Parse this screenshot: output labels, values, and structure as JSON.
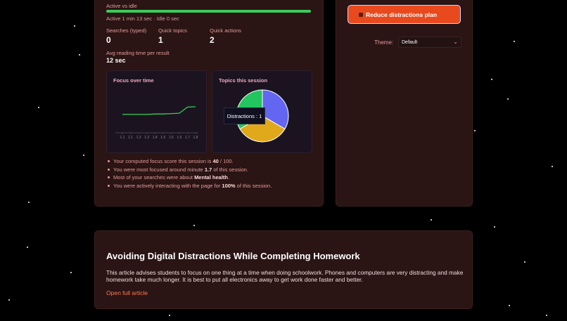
{
  "activity": {
    "title": "Active vs idle",
    "status": "Active 1 min 13 sec · Idle 0 sec",
    "active_fraction": 1.0,
    "bar_color": "#3ccb5b"
  },
  "stats": [
    {
      "label": "Searches (typed)",
      "value": "0"
    },
    {
      "label": "Quick topics",
      "value": "1"
    },
    {
      "label": "Quick actions",
      "value": "2"
    }
  ],
  "reading": {
    "label": "Avg reading time per result",
    "value": "12 sec"
  },
  "focus_chart": {
    "title": "Focus over time",
    "x_ticks": [
      "1.1",
      "1.1",
      "1.2",
      "1.3",
      "1.4",
      "1.5",
      "1.6",
      "1.6",
      "1.7",
      "1.8"
    ],
    "chart_data": {
      "type": "line",
      "x": [
        "1.1",
        "1.1",
        "1.2",
        "1.3",
        "1.4",
        "1.5",
        "1.6",
        "1.6",
        "1.7",
        "1.8"
      ],
      "y": [
        0.45,
        0.45,
        0.45,
        0.45,
        0.46,
        0.46,
        0.47,
        0.48,
        0.63,
        0.64
      ],
      "color": "#3ccb5b"
    }
  },
  "topics_chart": {
    "title": "Topics this session",
    "tooltip": "Distractions : 1",
    "chart_data": {
      "type": "pie",
      "slices": [
        {
          "name": "Distractions",
          "value": 1,
          "color": "#6366f1"
        },
        {
          "name": "",
          "value": 1,
          "color": "#e0a91c"
        },
        {
          "name": "",
          "value": 1,
          "color": "#22c55e"
        }
      ]
    }
  },
  "insights": [
    {
      "pre": "Your computed focus score this session is ",
      "bold": "40",
      "post": " / 100."
    },
    {
      "pre": "You were most focused around minute ",
      "bold": "1.7",
      "post": " of this session."
    },
    {
      "pre": "Most of your searches were about ",
      "bold": "Mental health",
      "post": "."
    },
    {
      "pre": "You were actively interacting with the page for ",
      "bold": "100%",
      "post": " of this session."
    }
  ],
  "side": {
    "button_label": "Reduce distractions plan",
    "theme_label": "Theme:",
    "theme_value": "Default"
  },
  "article": {
    "title": "Avoiding Digital Distractions While Completing Homework",
    "body": "This article advises students to focus on one thing at a time when doing schoolwork. Phones and computers are very distracting and make homework take much longer. It is best to put all electronics away to get work done faster and better.",
    "link": "Open full article"
  }
}
